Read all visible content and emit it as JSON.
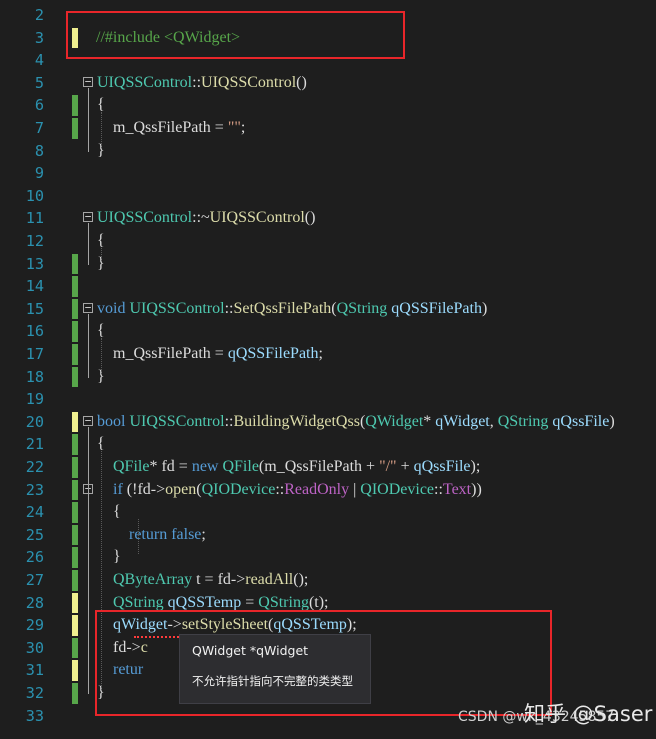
{
  "editor": {
    "lines": [
      {
        "n": "2",
        "change": "",
        "fold": "",
        "segs": []
      },
      {
        "n": "3",
        "change": "unsaved",
        "fold": "",
        "segs": [
          [
            "cmt",
            "//#include <QWidget>"
          ]
        ]
      },
      {
        "n": "4",
        "change": "",
        "fold": "",
        "segs": []
      },
      {
        "n": "5",
        "change": "",
        "fold": "−",
        "segs": [
          [
            "type",
            "UIQSSControl"
          ],
          [
            "",
            "::"
          ],
          [
            "fn",
            "UIQSSControl"
          ],
          [
            "",
            "()"
          ]
        ]
      },
      {
        "n": "6",
        "change": "saved",
        "fold": "",
        "segs": [
          [
            "",
            "{"
          ]
        ]
      },
      {
        "n": "7",
        "change": "saved",
        "fold": "",
        "segs": [
          [
            "",
            "    m_QssFilePath = "
          ],
          [
            "str",
            "\"\""
          ],
          [
            "",
            ";"
          ]
        ]
      },
      {
        "n": "8",
        "change": "",
        "fold": "",
        "segs": [
          [
            "",
            "}"
          ]
        ]
      },
      {
        "n": "9",
        "change": "",
        "fold": "",
        "segs": []
      },
      {
        "n": "10",
        "change": "",
        "fold": "",
        "segs": []
      },
      {
        "n": "11",
        "change": "",
        "fold": "−",
        "segs": [
          [
            "type",
            "UIQSSControl"
          ],
          [
            "",
            "::~"
          ],
          [
            "fn",
            "UIQSSControl"
          ],
          [
            "",
            "()"
          ]
        ]
      },
      {
        "n": "12",
        "change": "",
        "fold": "",
        "segs": [
          [
            "",
            "{"
          ]
        ]
      },
      {
        "n": "13",
        "change": "saved",
        "fold": "",
        "segs": [
          [
            "",
            "}"
          ]
        ]
      },
      {
        "n": "14",
        "change": "saved",
        "fold": "",
        "segs": []
      },
      {
        "n": "15",
        "change": "saved",
        "fold": "−",
        "segs": [
          [
            "kw",
            "void "
          ],
          [
            "type",
            "UIQSSControl"
          ],
          [
            "",
            "::"
          ],
          [
            "fn",
            "SetQssFilePath"
          ],
          [
            "",
            "("
          ],
          [
            "type",
            "QString"
          ],
          [
            "var",
            " qQSSFilePath"
          ],
          [
            "",
            ")"
          ]
        ]
      },
      {
        "n": "16",
        "change": "saved",
        "fold": "",
        "segs": [
          [
            "",
            "{"
          ]
        ]
      },
      {
        "n": "17",
        "change": "saved",
        "fold": "",
        "segs": [
          [
            "",
            "    m_QssFilePath = "
          ],
          [
            "var",
            "qQSSFilePath"
          ],
          [
            "",
            ";"
          ]
        ]
      },
      {
        "n": "18",
        "change": "saved",
        "fold": "",
        "segs": [
          [
            "",
            "}"
          ]
        ]
      },
      {
        "n": "19",
        "change": "",
        "fold": "",
        "segs": []
      },
      {
        "n": "20",
        "change": "unsaved",
        "fold": "−",
        "segs": [
          [
            "kw",
            "bool "
          ],
          [
            "type",
            "UIQSSControl"
          ],
          [
            "",
            "::"
          ],
          [
            "fn",
            "BuildingWidgetQss"
          ],
          [
            "",
            "("
          ],
          [
            "type",
            "QWidget"
          ],
          [
            "",
            "* "
          ],
          [
            "var",
            "qWidget"
          ],
          [
            "",
            ", "
          ],
          [
            "type",
            "QString"
          ],
          [
            "var",
            " qQssFile"
          ],
          [
            "",
            ")"
          ]
        ]
      },
      {
        "n": "21",
        "change": "saved",
        "fold": "",
        "segs": [
          [
            "",
            "{"
          ]
        ]
      },
      {
        "n": "22",
        "change": "saved",
        "fold": "",
        "segs": [
          [
            "",
            "    "
          ],
          [
            "type",
            "QFile"
          ],
          [
            "",
            "* fd = "
          ],
          [
            "kw",
            "new "
          ],
          [
            "type",
            "QFile"
          ],
          [
            "",
            "(m_QssFilePath + "
          ],
          [
            "str",
            "\"/\""
          ],
          [
            "",
            " + "
          ],
          [
            "var",
            "qQssFile"
          ],
          [
            "",
            ");"
          ]
        ]
      },
      {
        "n": "23",
        "change": "saved",
        "fold": "−",
        "segs": [
          [
            "",
            "    "
          ],
          [
            "kw",
            "if "
          ],
          [
            "",
            "(!fd->"
          ],
          [
            "fn",
            "open"
          ],
          [
            "",
            "("
          ],
          [
            "type",
            "QIODevice"
          ],
          [
            "",
            "::"
          ],
          [
            "macro",
            "ReadOnly"
          ],
          [
            "",
            " | "
          ],
          [
            "type",
            "QIODevice"
          ],
          [
            "",
            "::"
          ],
          [
            "macro",
            "Text"
          ],
          [
            "",
            "))"
          ]
        ]
      },
      {
        "n": "24",
        "change": "saved",
        "fold": "",
        "segs": [
          [
            "",
            "    {"
          ]
        ]
      },
      {
        "n": "25",
        "change": "saved",
        "fold": "",
        "segs": [
          [
            "",
            "        "
          ],
          [
            "kw",
            "return false"
          ],
          [
            "",
            ";"
          ]
        ]
      },
      {
        "n": "26",
        "change": "saved",
        "fold": "",
        "segs": [
          [
            "",
            "    }"
          ]
        ]
      },
      {
        "n": "27",
        "change": "saved",
        "fold": "",
        "segs": [
          [
            "",
            "    "
          ],
          [
            "type",
            "QByteArray"
          ],
          [
            "",
            " t = fd->"
          ],
          [
            "fn",
            "readAll"
          ],
          [
            "",
            "();"
          ]
        ]
      },
      {
        "n": "28",
        "change": "unsaved",
        "fold": "",
        "segs": [
          [
            "",
            "    "
          ],
          [
            "type",
            "QString"
          ],
          [
            "var",
            " qQSSTemp"
          ],
          [
            "",
            " = "
          ],
          [
            "type",
            "QString"
          ],
          [
            "",
            "(t);"
          ]
        ]
      },
      {
        "n": "29",
        "change": "unsaved",
        "fold": "",
        "segs": [
          [
            "",
            "    "
          ],
          [
            "var",
            "qWidget"
          ],
          [
            "",
            "->"
          ],
          [
            "fn",
            "setStyleSheet"
          ],
          [
            "",
            "("
          ],
          [
            "var",
            "qQSSTemp"
          ],
          [
            "",
            ");"
          ]
        ]
      },
      {
        "n": "30",
        "change": "saved",
        "fold": "",
        "segs": [
          [
            "",
            "    fd->"
          ],
          [
            "fn",
            "c"
          ]
        ]
      },
      {
        "n": "31",
        "change": "unsaved",
        "fold": "",
        "segs": [
          [
            "",
            "    "
          ],
          [
            "kw",
            "retur"
          ]
        ]
      },
      {
        "n": "32",
        "change": "saved",
        "fold": "",
        "segs": [
          [
            "",
            "}"
          ]
        ]
      },
      {
        "n": "33",
        "change": "",
        "fold": "",
        "segs": []
      }
    ]
  },
  "tooltip": {
    "title": "QWidget *qWidget",
    "message": "不允许指针指向不完整的类类型"
  },
  "watermarks": {
    "zhihu": "知乎 @Saser",
    "csdn": "CSDN @wk_43245857"
  },
  "colors": {
    "background": "#1e1e1e",
    "highlight_box": "#e8262a",
    "error_squiggle": "#ff3b3b"
  }
}
